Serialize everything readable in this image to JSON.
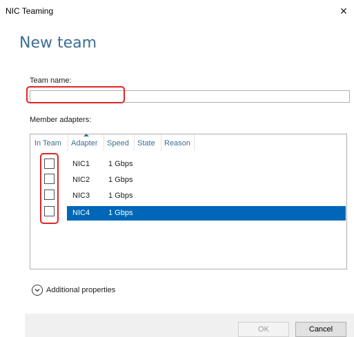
{
  "window": {
    "title": "NIC Teaming",
    "close_glyph": "✕"
  },
  "heading": "New team",
  "team_name": {
    "label": "Team name:",
    "value": ""
  },
  "member_adapters": {
    "label": "Member adapters:",
    "columns": [
      "In Team",
      "Adapter",
      "Speed",
      "State",
      "Reason"
    ],
    "sorted_column": "Adapter",
    "rows": [
      {
        "in_team": false,
        "adapter": "NIC1",
        "speed": "1 Gbps",
        "state": "",
        "reason": "",
        "selected": false
      },
      {
        "in_team": false,
        "adapter": "NIC2",
        "speed": "1 Gbps",
        "state": "",
        "reason": "",
        "selected": false
      },
      {
        "in_team": false,
        "adapter": "NIC3",
        "speed": "1 Gbps",
        "state": "",
        "reason": "",
        "selected": false
      },
      {
        "in_team": false,
        "adapter": "NIC4",
        "speed": "1 Gbps",
        "state": "",
        "reason": "",
        "selected": true
      }
    ]
  },
  "additional_properties": {
    "label": "Additional properties",
    "icon": "chevron-down-circle-icon"
  },
  "buttons": {
    "ok": "OK",
    "cancel": "Cancel"
  },
  "colors": {
    "accent": "#3b6e8f",
    "selection": "#0067b8",
    "annotation": "#e02424"
  }
}
